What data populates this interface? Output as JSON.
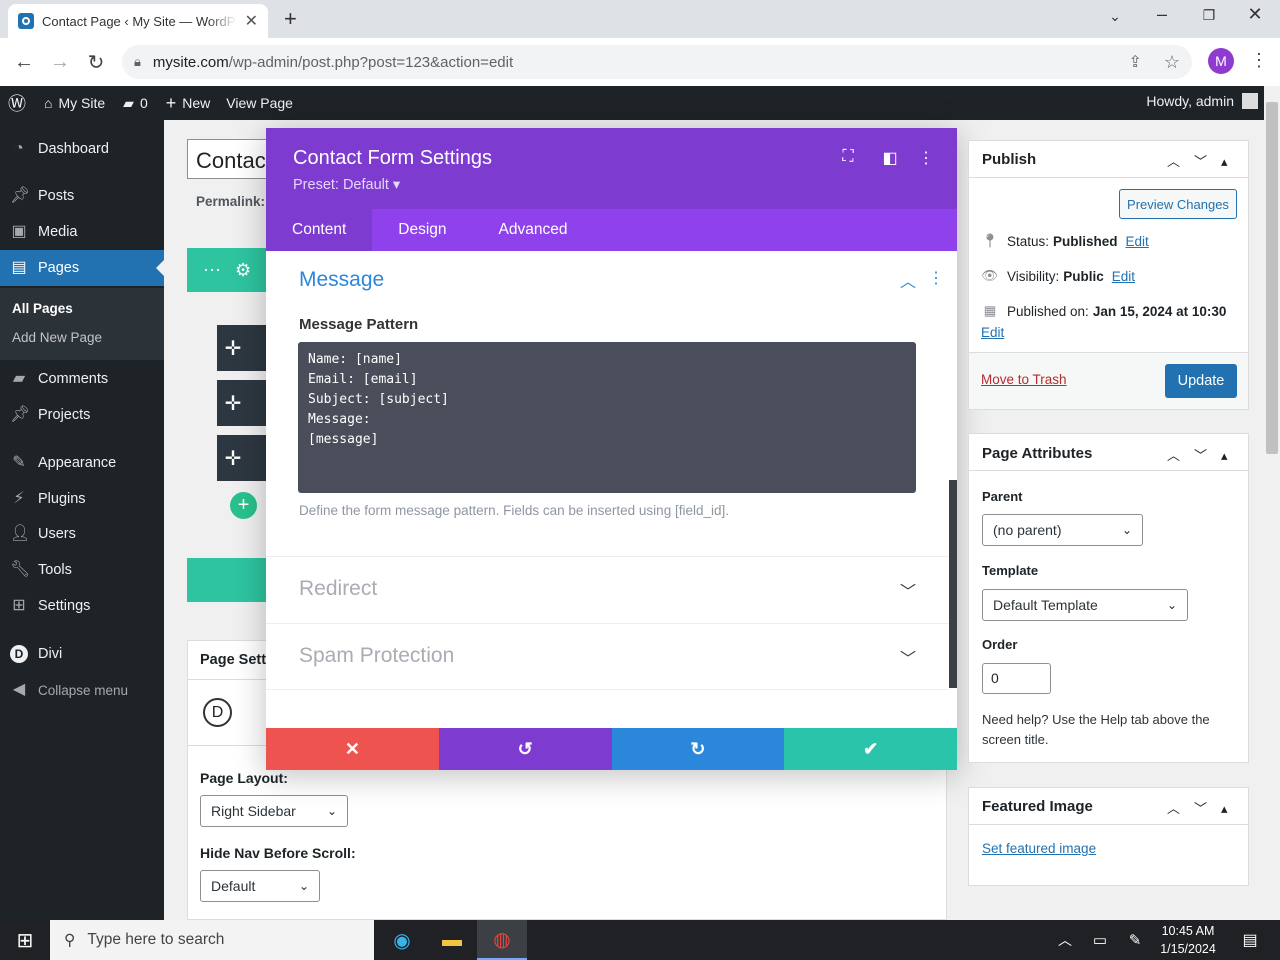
{
  "browser": {
    "tab_title": "Contact Page ‹ My Site — WordPress",
    "new_tab": "+",
    "url_host": "mysite.com",
    "url_path": "/wp-admin/post.php?post=123&action=edit",
    "profile_initial": "M"
  },
  "adminbar": {
    "site_name": "My Site",
    "comments_count": "0",
    "new_label": "New",
    "view_label": "View Page",
    "howdy": "Howdy, admin"
  },
  "sidebar": {
    "items": [
      {
        "label": "Dashboard",
        "icon": "dashboard-icon"
      },
      {
        "label": "Posts",
        "icon": "pin-icon"
      },
      {
        "label": "Media",
        "icon": "media-icon"
      },
      {
        "label": "Pages",
        "icon": "pages-icon"
      },
      {
        "label": "Comments",
        "icon": "comment-icon"
      },
      {
        "label": "Projects",
        "icon": "pin-icon"
      },
      {
        "label": "Appearance",
        "icon": "brush-icon"
      },
      {
        "label": "Plugins",
        "icon": "plugin-icon"
      },
      {
        "label": "Users",
        "icon": "user-icon"
      },
      {
        "label": "Tools",
        "icon": "wrench-icon"
      },
      {
        "label": "Settings",
        "icon": "settings-icon"
      },
      {
        "label": "Divi",
        "icon": "divi-icon"
      },
      {
        "label": "Collapse menu",
        "icon": "collapse-icon"
      }
    ],
    "submenu": {
      "all_pages": "All Pages",
      "add_new": "Add New Page"
    }
  },
  "editor": {
    "title_value": "Contact",
    "permalink_label": "Permalink:",
    "page_settings": "Page Setti",
    "divi_logo": "D",
    "page_layout_label": "Page Layout:",
    "page_layout_value": "Right Sidebar",
    "hide_nav_label": "Hide Nav Before Scroll:",
    "hide_nav_value": "Default"
  },
  "modal": {
    "title": "Contact Form Settings",
    "preset": "Preset: Default ▾",
    "tabs": [
      "Content",
      "Design",
      "Advanced"
    ],
    "section_open": "Message",
    "message_pattern_label": "Message Pattern",
    "message_pattern_value": "Name: [name]\nEmail: [email]\nSubject: [subject]\nMessage:\n[message]",
    "message_help": "Define the form message pattern. Fields can be inserted using [field_id].",
    "section_redirect": "Redirect",
    "section_spam": "Spam Protection",
    "colors": {
      "header": "#7e3bd0",
      "tabs": "#8f42ec",
      "cancel": "#ef5350",
      "undo": "#7e3bd0",
      "redo": "#2b87da",
      "save": "#29c4a9"
    }
  },
  "publish": {
    "title": "Publish",
    "preview": "Preview Changes",
    "status_label": "Status:",
    "status_value": "Published",
    "visibility_label": "Visibility:",
    "visibility_value": "Public",
    "published_label": "Published on:",
    "published_value": "Jan 15, 2024 at 10:30",
    "edit": "Edit",
    "trash": "Move to Trash",
    "update": "Update"
  },
  "attributes": {
    "title": "Page Attributes",
    "parent_label": "Parent",
    "parent_value": "(no parent)",
    "template_label": "Template",
    "template_value": "Default Template",
    "order_label": "Order",
    "order_value": "0",
    "help": "Need help? Use the Help tab above the screen title."
  },
  "featured": {
    "title": "Featured Image",
    "link": "Set featured image"
  },
  "taskbar": {
    "search_placeholder": "Type here to search",
    "time": "10:45 AM",
    "date": "1/15/2024"
  }
}
